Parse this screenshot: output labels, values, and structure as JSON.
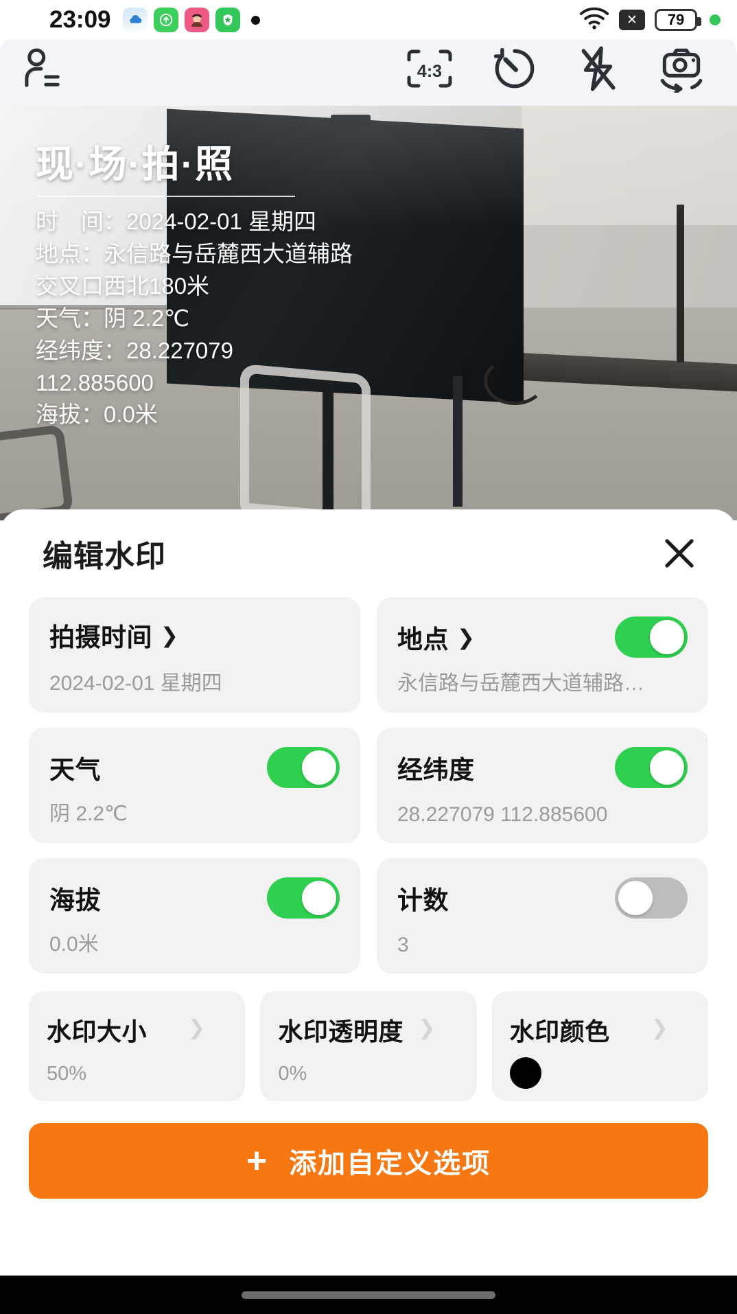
{
  "status_bar": {
    "time": "23:09",
    "notification_icons": [
      "cloud-app-icon",
      "upload-arrow-app-icon",
      "avatar-app-icon",
      "shield-app-icon"
    ],
    "wifi_icon": "wifi-icon",
    "signal_x_icon": "x-signal-icon",
    "battery_percent": "79",
    "indicator_dot": "green-status-dot"
  },
  "camera_toolbar": {
    "profile_icon": "user-list-icon",
    "aspect_ratio_label": "4:3",
    "timer_icon": "timer-icon",
    "flash_icon": "flash-off-icon",
    "switch_camera_icon": "camera-switch-icon"
  },
  "photo_watermark": {
    "title": "现·场·拍·照",
    "lines": [
      "时　间：2024-02-01 星期四",
      "地点：永信路与岳麓西大道辅路",
      "交叉口西北180米",
      "天气：阴  2.2℃",
      "经纬度：28.227079",
      "112.885600",
      "海拔：0.0米"
    ]
  },
  "sheet": {
    "title": "编辑水印",
    "close_icon": "close-icon",
    "options": [
      {
        "label": "拍摄时间",
        "value": "2024-02-01 星期四",
        "chevron": "chevron-right-icon",
        "has_toggle": false,
        "toggle_on": false
      },
      {
        "label": "地点",
        "value": "永信路与岳麓西大道辅路…",
        "chevron": "chevron-right-icon",
        "has_toggle": true,
        "toggle_on": true
      },
      {
        "label": "天气",
        "value": "阴  2.2℃",
        "chevron": "",
        "has_toggle": true,
        "toggle_on": true
      },
      {
        "label": "经纬度",
        "value": "28.227079  112.885600",
        "chevron": "",
        "has_toggle": true,
        "toggle_on": true
      },
      {
        "label": "海拔",
        "value": "0.0米",
        "chevron": "",
        "has_toggle": true,
        "toggle_on": true
      },
      {
        "label": "计数",
        "value": "3",
        "chevron": "",
        "has_toggle": true,
        "toggle_on": false
      }
    ],
    "style_options": [
      {
        "label": "水印大小",
        "value": "50%",
        "chevron": "chevron-right-icon",
        "type": "text"
      },
      {
        "label": "水印透明度",
        "value": "0%",
        "chevron": "chevron-right-icon",
        "type": "text"
      },
      {
        "label": "水印颜色",
        "value": "",
        "chevron": "chevron-right-icon",
        "type": "swatch",
        "swatch_color": "#000000"
      }
    ],
    "add_button": {
      "plus": "+",
      "label": "添加自定义选项"
    }
  },
  "colors": {
    "accent_green": "#2fd04f",
    "button_orange": "#f77812",
    "card_gray": "#f2f2f2",
    "value_gray": "#9b9b9b"
  }
}
